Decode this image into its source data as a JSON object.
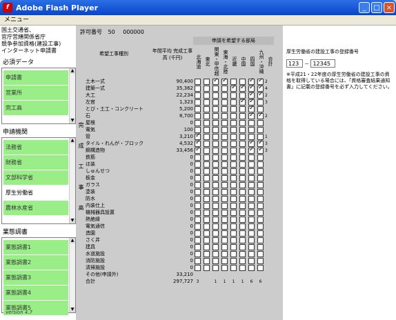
{
  "window": {
    "title": "Adobe Flash Player",
    "menu": "メニュー"
  },
  "ministry": [
    "国土交通省、",
    "官庁営繕関係省庁",
    "競争参加資格(建設工事)",
    "インターネット申請書"
  ],
  "required": {
    "label": "必須データ",
    "items": [
      "申請書",
      "営業所",
      "完工高"
    ]
  },
  "agencies": {
    "label": "申請機関",
    "items": [
      {
        "label": "法務省",
        "sel": true
      },
      {
        "label": "財務省",
        "sel": true
      },
      {
        "label": "文部科学省",
        "sel": true
      },
      {
        "label": "厚生労働省",
        "sel": false
      },
      {
        "label": "農林水産省",
        "sel": true
      }
    ]
  },
  "survey": {
    "label": "業態調書",
    "items": [
      "業態調書1",
      "業態調書2",
      "業態調書3",
      "業態調書4",
      "業態調書5"
    ]
  },
  "version": "version 4.7",
  "permit": {
    "label": "許可番号",
    "a": "50",
    "b": "000000"
  },
  "header": {
    "type": "希望工事種別",
    "amount": "年間平均 完成工事高 (千円)",
    "regions_title": "申請を希望する部局",
    "regions": [
      "北海道",
      "東北",
      "関東・甲信越",
      "東海・北陸",
      "近畿",
      "中国",
      "四国",
      "九州・沖縄",
      "合計"
    ],
    "side": "完成工事高"
  },
  "rows": [
    {
      "t": "土木一式",
      "a": "90,400",
      "c": [
        0,
        0,
        1,
        1,
        0,
        0,
        1,
        1
      ],
      "n": "2"
    },
    {
      "t": "建築一式",
      "a": "35,362",
      "c": [
        0,
        0,
        0,
        0,
        1,
        1,
        1,
        1
      ],
      "n": "4"
    },
    {
      "t": "大工",
      "a": "22,234",
      "c": [
        0,
        0,
        0,
        0,
        0,
        0,
        1,
        1
      ],
      "n": "2"
    },
    {
      "t": "左官",
      "a": "1,323",
      "c": [
        0,
        0,
        0,
        0,
        0,
        1,
        1,
        0
      ],
      "n": "3"
    },
    {
      "t": "とび・土工・コンクリート",
      "a": "5,200",
      "c": [
        0,
        0,
        0,
        0,
        0,
        0,
        1,
        0
      ],
      "n": ""
    },
    {
      "t": "石",
      "a": "8,700",
      "c": [
        0,
        0,
        0,
        0,
        0,
        0,
        1,
        1
      ],
      "n": "2"
    },
    {
      "t": "屋根",
      "a": "0",
      "c": [
        0,
        0,
        0,
        0,
        0,
        0,
        0,
        0
      ],
      "n": ""
    },
    {
      "t": "電気",
      "a": "100",
      "c": [
        0,
        0,
        0,
        0,
        0,
        0,
        0,
        0
      ],
      "n": ""
    },
    {
      "t": "管",
      "a": "3,210",
      "c": [
        1,
        0,
        0,
        0,
        0,
        0,
        0,
        0
      ],
      "n": "1"
    },
    {
      "t": "タイル・れんが・ブロック",
      "a": "4,532",
      "c": [
        1,
        0,
        0,
        0,
        0,
        0,
        1,
        1
      ],
      "n": "3"
    },
    {
      "t": "鋼構造物",
      "a": "33,456",
      "c": [
        1,
        0,
        0,
        0,
        0,
        0,
        1,
        1
      ],
      "n": "3"
    },
    {
      "t": "鉄筋",
      "a": "0",
      "c": [
        0,
        0,
        0,
        0,
        0,
        0,
        0,
        0
      ],
      "n": ""
    },
    {
      "t": "ほ装",
      "a": "0",
      "c": [
        0,
        0,
        0,
        0,
        0,
        0,
        0,
        0
      ],
      "n": ""
    },
    {
      "t": "しゅんせつ",
      "a": "0",
      "c": [
        0,
        0,
        0,
        0,
        0,
        0,
        0,
        0
      ],
      "n": ""
    },
    {
      "t": "板金",
      "a": "0",
      "c": [
        0,
        0,
        0,
        0,
        0,
        0,
        0,
        0
      ],
      "n": ""
    },
    {
      "t": "ガラス",
      "a": "0",
      "c": [
        0,
        0,
        0,
        0,
        0,
        0,
        0,
        0
      ],
      "n": ""
    },
    {
      "t": "塗装",
      "a": "0",
      "c": [
        0,
        0,
        0,
        0,
        0,
        0,
        0,
        0
      ],
      "n": ""
    },
    {
      "t": "防水",
      "a": "0",
      "c": [
        0,
        0,
        0,
        0,
        0,
        0,
        0,
        0
      ],
      "n": ""
    },
    {
      "t": "内装仕上",
      "a": "0",
      "c": [
        0,
        0,
        0,
        0,
        0,
        0,
        0,
        0
      ],
      "n": ""
    },
    {
      "t": "機械器具設置",
      "a": "0",
      "c": [
        0,
        0,
        0,
        0,
        0,
        0,
        0,
        0
      ],
      "n": ""
    },
    {
      "t": "熱絶縁",
      "a": "0",
      "c": [
        0,
        0,
        0,
        0,
        0,
        0,
        0,
        0
      ],
      "n": ""
    },
    {
      "t": "電気通信",
      "a": "0",
      "c": [
        0,
        0,
        0,
        0,
        0,
        0,
        0,
        0
      ],
      "n": ""
    },
    {
      "t": "造園",
      "a": "0",
      "c": [
        0,
        0,
        0,
        0,
        0,
        0,
        0,
        0
      ],
      "n": ""
    },
    {
      "t": "さく井",
      "a": "0",
      "c": [
        0,
        0,
        0,
        0,
        0,
        0,
        0,
        0
      ],
      "n": ""
    },
    {
      "t": "建具",
      "a": "0",
      "c": [
        0,
        0,
        0,
        0,
        0,
        0,
        0,
        0
      ],
      "n": ""
    },
    {
      "t": "水道施設",
      "a": "0",
      "c": [
        0,
        0,
        0,
        0,
        0,
        0,
        0,
        0
      ],
      "n": ""
    },
    {
      "t": "消防施設",
      "a": "0",
      "c": [
        0,
        0,
        0,
        0,
        0,
        0,
        0,
        0
      ],
      "n": ""
    },
    {
      "t": "清掃施設",
      "a": "0",
      "c": [
        0,
        0,
        0,
        0,
        0,
        0,
        0,
        0
      ],
      "n": ""
    }
  ],
  "other": {
    "t": "その他(申請外)",
    "a": "33,210"
  },
  "total": {
    "t": "合計",
    "a": "297,727",
    "c": [
      "3",
      "",
      "1",
      "1",
      "1",
      "1",
      "6",
      "6"
    ]
  },
  "right": {
    "label": "厚生労働省の建設工事の登録番号",
    "v1": "123",
    "sep": "－",
    "v2": "12345",
    "note": "※平成21・22年度の厚生労働省の建設工事の資格を取得している場合には、「資格審査結果通知書」に記載の登録番号を必ず入力してください。"
  }
}
